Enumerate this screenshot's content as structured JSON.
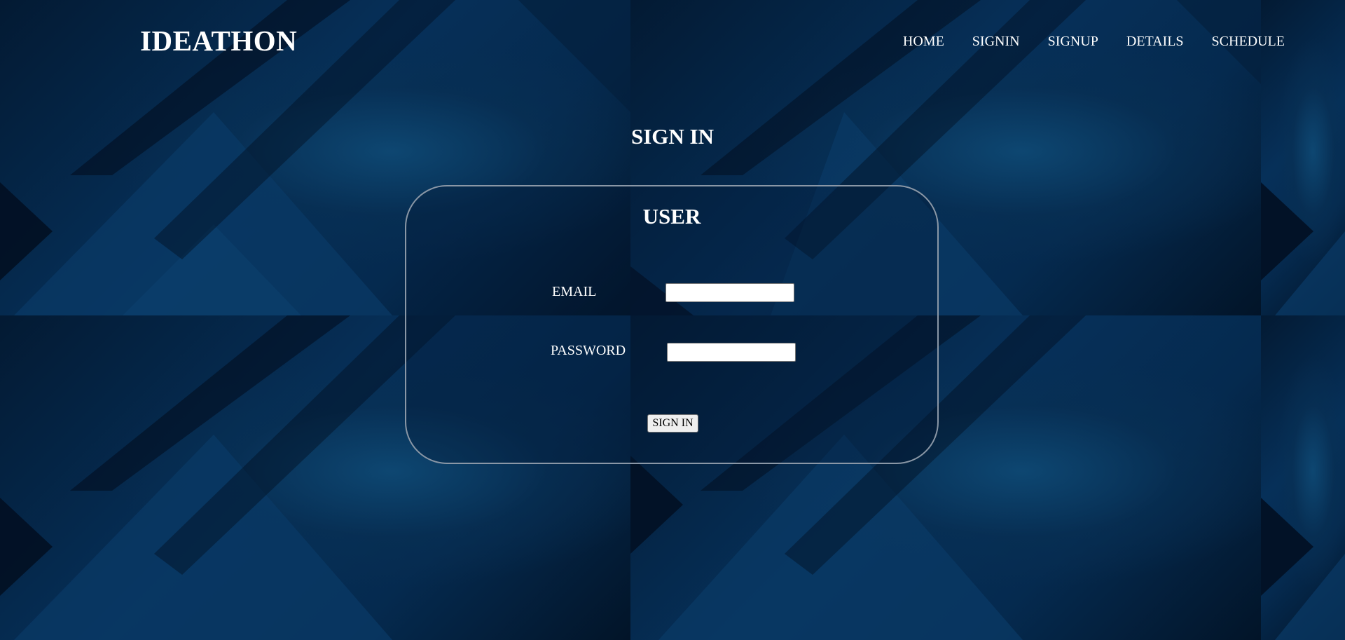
{
  "header": {
    "logo": "IDEATHON",
    "nav": {
      "home": "HOME",
      "signin": "SIGNIN",
      "signup": "SIGNUP",
      "details": "DETAILS",
      "schedule": "SCHEDULE"
    }
  },
  "page": {
    "title": "SIGN IN"
  },
  "form": {
    "title": "USER",
    "email_label": "EMAIL",
    "email_value": "",
    "password_label": "PASSWORD",
    "password_value": "",
    "submit_label": "SIGN IN"
  },
  "colors": {
    "background": "#052543",
    "text": "#ffffff",
    "card_border": "#8a97a6"
  }
}
